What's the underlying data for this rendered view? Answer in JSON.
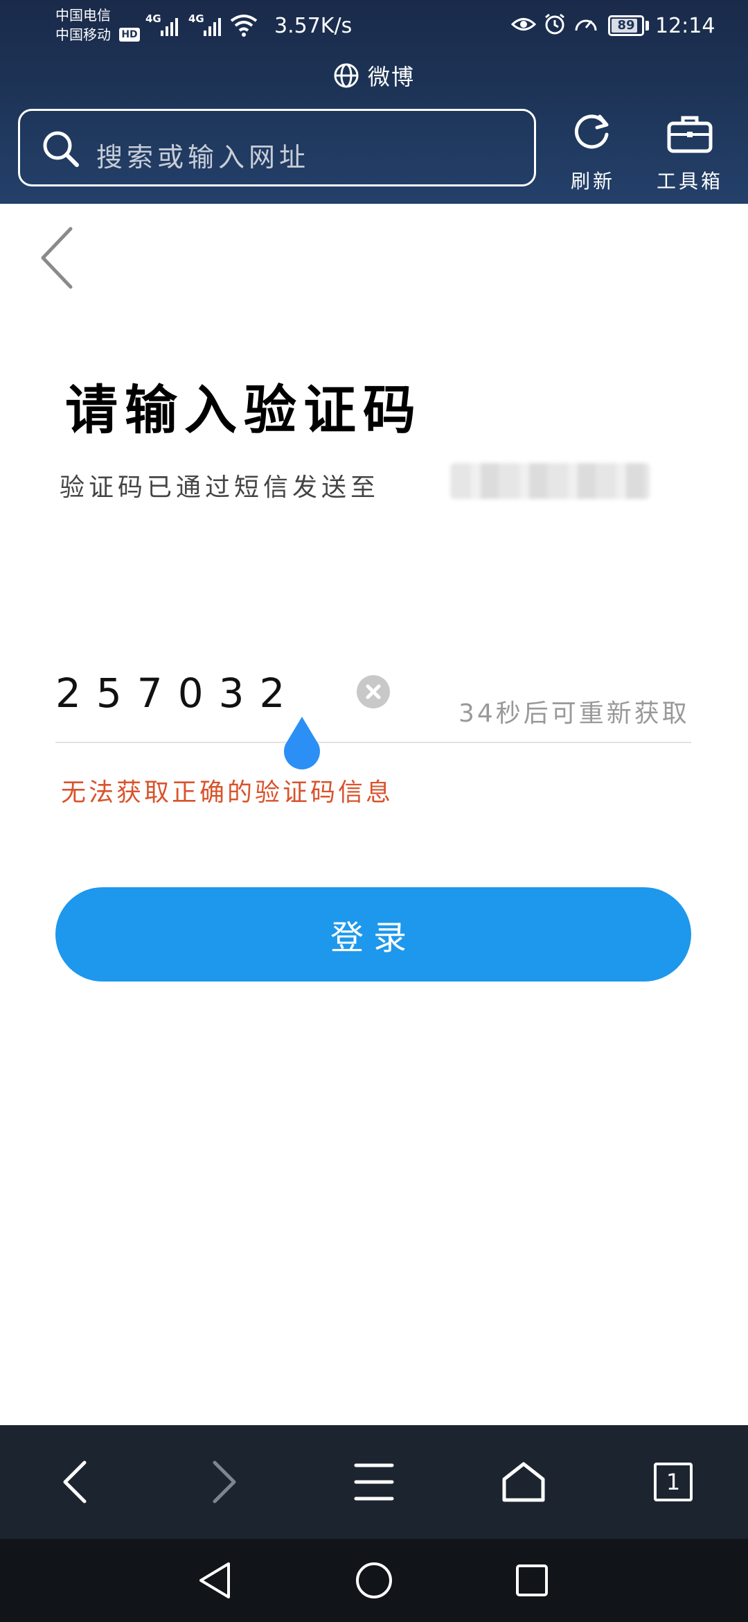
{
  "status_bar": {
    "carrier_1": "中国电信",
    "carrier_2": "中国移动",
    "hd_label": "HD",
    "network_1": "4G",
    "network_2": "4G",
    "net_speed": "3.57K/s",
    "battery_level": 89,
    "battery_text": "89",
    "time": "12:14"
  },
  "browser": {
    "site_title": "微博",
    "search_placeholder": "搜索或输入网址",
    "refresh_label": "刷新",
    "toolbox_label": "工具箱",
    "tab_count": "1"
  },
  "page": {
    "title": "请输入验证码",
    "subtitle": "验证码已通过短信发送至",
    "code_value": "257032",
    "resend_text": "34秒后可重新获取",
    "error_text": "无法获取正确的验证码信息",
    "login_label": "登录"
  },
  "colors": {
    "accent": "#1d98ec",
    "error": "#d9532c",
    "top_bar": "#1d3457"
  }
}
